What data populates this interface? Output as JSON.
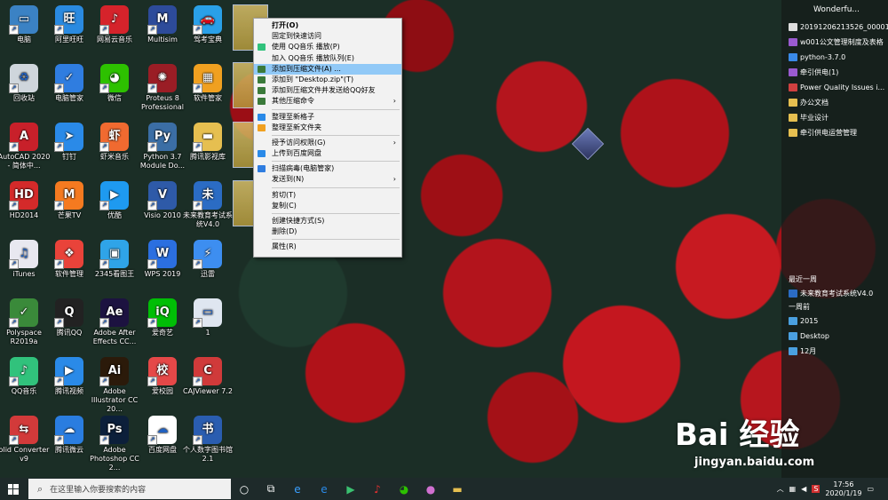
{
  "desktop_icons": [
    {
      "label": "电脑",
      "icon": "computer-icon",
      "color": "#3b82c4"
    },
    {
      "label": "阿里旺旺",
      "icon": "aliwangwang-icon",
      "color": "#2a8ae0"
    },
    {
      "label": "网易云音乐",
      "icon": "netease-music-icon",
      "color": "#d5232b"
    },
    {
      "label": "Multisim",
      "icon": "multisim-icon",
      "color": "#2d4b9a"
    },
    {
      "label": "驾考宝典",
      "icon": "car-icon",
      "color": "#2aa0e8"
    },
    {
      "label": "回收站",
      "icon": "recycle-bin-icon",
      "color": "#cfd6dc"
    },
    {
      "label": "电脑管家",
      "icon": "shield-icon",
      "color": "#2f7de0"
    },
    {
      "label": "微信",
      "icon": "wechat-icon",
      "color": "#2dc100"
    },
    {
      "label": "Proteus 8 Professional",
      "icon": "proteus-icon",
      "color": "#9a1d25"
    },
    {
      "label": "软件管家",
      "icon": "software-manager-icon",
      "color": "#f0a020"
    },
    {
      "label": "AutoCAD 2020 - 简体中...",
      "icon": "autocad-icon",
      "color": "#c8202a"
    },
    {
      "label": "钉钉",
      "icon": "dingtalk-icon",
      "color": "#2a8ae8"
    },
    {
      "label": "虾米音乐",
      "icon": "xiami-icon",
      "color": "#f06a30"
    },
    {
      "label": "Python 3.7 Module Do...",
      "icon": "python-icon",
      "color": "#3b6ea5"
    },
    {
      "label": "腾讯影视库",
      "icon": "folder-icon",
      "color": "#e6bf50"
    },
    {
      "label": "HD2014",
      "icon": "hd-icon",
      "color": "#d42a2a"
    },
    {
      "label": "芒果TV",
      "icon": "mango-tv-icon",
      "color": "#f57a20"
    },
    {
      "label": "优酷",
      "icon": "youku-icon",
      "color": "#1e9af0"
    },
    {
      "label": "Visio 2010",
      "icon": "visio-icon",
      "color": "#2e5aa8"
    },
    {
      "label": "未来教育考试系统V4.0",
      "icon": "exam-system-icon",
      "color": "#2b6cc4"
    },
    {
      "label": "iTunes",
      "icon": "itunes-icon",
      "color": "#e8e8f0"
    },
    {
      "label": "软件管理",
      "icon": "software-manage-icon",
      "color": "#e9433a"
    },
    {
      "label": "2345看图王",
      "icon": "image-viewer-icon",
      "color": "#2fa4e8"
    },
    {
      "label": "WPS 2019",
      "icon": "wps-icon",
      "color": "#2b6fe0"
    },
    {
      "label": "迅雷",
      "icon": "thunder-icon",
      "color": "#3d8ef0"
    },
    {
      "label": "Polyspace R2019a",
      "icon": "polyspace-icon",
      "color": "#3a8a3a"
    },
    {
      "label": "腾讯QQ",
      "icon": "qq-icon",
      "color": "#222222"
    },
    {
      "label": "Adobe After Effects CC...",
      "icon": "after-effects-icon",
      "color": "#1c1240"
    },
    {
      "label": "爱奇艺",
      "icon": "iqiyi-icon",
      "color": "#00be06"
    },
    {
      "label": "1",
      "icon": "file-icon",
      "color": "#dfe6f0"
    },
    {
      "label": "QQ音乐",
      "icon": "qq-music-icon",
      "color": "#31c27c"
    },
    {
      "label": "腾讯视频",
      "icon": "tencent-video-icon",
      "color": "#2a8ae8"
    },
    {
      "label": "Adobe Illustrator CC 20...",
      "icon": "illustrator-icon",
      "color": "#2b1a0a"
    },
    {
      "label": "爱校园",
      "icon": "campus-icon",
      "color": "#e54848"
    },
    {
      "label": "CAJViewer 7.2",
      "icon": "cajviewer-icon",
      "color": "#d03a3a"
    },
    {
      "label": "olid Converter v9",
      "icon": "converter-icon",
      "color": "#d23a3a"
    },
    {
      "label": "腾讯微云",
      "icon": "weiyun-icon",
      "color": "#2a7de0"
    },
    {
      "label": "Adobe Photoshop CC 2...",
      "icon": "photoshop-icon",
      "color": "#0c1f3a"
    },
    {
      "label": "百度网盘",
      "icon": "baidu-netdisk-icon",
      "color": "#ffffff"
    },
    {
      "label": "个人数字图书馆2.1",
      "icon": "digital-library-icon",
      "color": "#2a5db0"
    }
  ],
  "glyphs": {
    "computer-icon": "▭",
    "aliwangwang-icon": "旺",
    "netease-music-icon": "♪",
    "multisim-icon": "M",
    "car-icon": "🚗",
    "recycle-bin-icon": "♻",
    "shield-icon": "✓",
    "wechat-icon": "◕",
    "proteus-icon": "✺",
    "software-manager-icon": "▦",
    "autocad-icon": "A",
    "dingtalk-icon": "➤",
    "xiami-icon": "虾",
    "python-icon": "Py",
    "folder-icon": "▬",
    "hd-icon": "HD",
    "mango-tv-icon": "M",
    "youku-icon": "▶",
    "visio-icon": "V",
    "exam-system-icon": "未",
    "itunes-icon": "♫",
    "software-manage-icon": "❖",
    "image-viewer-icon": "▣",
    "wps-icon": "W",
    "thunder-icon": "⚡",
    "polyspace-icon": "✓",
    "qq-icon": "Q",
    "after-effects-icon": "Ae",
    "iqiyi-icon": "iQ",
    "file-icon": "▭",
    "qq-music-icon": "♪",
    "tencent-video-icon": "▶",
    "illustrator-icon": "Ai",
    "campus-icon": "校",
    "cajviewer-icon": "C",
    "converter-icon": "⇆",
    "weiyun-icon": "☁",
    "photoshop-icon": "Ps",
    "baidu-netdisk-icon": "☁",
    "digital-library-icon": "书"
  },
  "context_menu": [
    {
      "label": "打开(O)",
      "bold": true
    },
    {
      "label": "固定到快速访问"
    },
    {
      "label": "使用 QQ音乐 播放(P)",
      "icon_color": "#31c27c"
    },
    {
      "label": "加入 QQ音乐 播放队列(E)"
    },
    {
      "label": "添加到压缩文件(A) ...",
      "highlight": true,
      "icon_color": "#3a7a3a"
    },
    {
      "label": "添加到 \"Desktop.zip\"(T)",
      "icon_color": "#3a7a3a"
    },
    {
      "label": "添加到压缩文件并发送给QQ好友",
      "icon_color": "#3a7a3a"
    },
    {
      "label": "其他压缩命令",
      "submenu": true,
      "icon_color": "#3a7a3a"
    },
    {
      "sep": true
    },
    {
      "label": "整理至新格子",
      "icon_color": "#2a8ae8"
    },
    {
      "label": "整理至新文件夹",
      "icon_color": "#f0a020"
    },
    {
      "sep": true
    },
    {
      "label": "授予访问权限(G)",
      "submenu": true
    },
    {
      "label": "上传到百度网盘",
      "icon_color": "#2a8ae8"
    },
    {
      "sep": true
    },
    {
      "label": "扫描病毒(电脑管家)",
      "icon_color": "#2f7de0"
    },
    {
      "label": "发送到(N)",
      "submenu": true
    },
    {
      "sep": true
    },
    {
      "label": "剪切(T)"
    },
    {
      "label": "复制(C)"
    },
    {
      "sep": true
    },
    {
      "label": "创建快捷方式(S)"
    },
    {
      "label": "删除(D)"
    },
    {
      "sep": true
    },
    {
      "label": "属性(R)"
    }
  ],
  "right_panel": {
    "title": "Wonderfu...",
    "items": [
      {
        "label": "20191206213526_00001",
        "color": "#dddddd"
      },
      {
        "label": "w001公文管理制度及表格",
        "color": "#9a5ad0"
      },
      {
        "label": "python-3.7.0",
        "color": "#3a8ae8"
      },
      {
        "label": "牵引供电(1)",
        "color": "#9a5ad0"
      },
      {
        "label": "Power Quality Issues i...",
        "color": "#d04040"
      },
      {
        "label": "办公文档",
        "color": "#e6bf50"
      },
      {
        "label": "毕业设计",
        "color": "#e6bf50"
      },
      {
        "label": "牵引供电运营管理",
        "color": "#e6bf50"
      }
    ],
    "recent_week_label": "最近一周",
    "recent_week_items": [
      {
        "label": "未来教育考试系统V4.0",
        "color": "#2b6cc4"
      }
    ],
    "week_ago_label": "一周前",
    "week_ago_items": [
      {
        "label": "2015",
        "color": "#4aa0e0"
      },
      {
        "label": "Desktop",
        "color": "#4aa0e0"
      },
      {
        "label": "12月",
        "color": "#4aa0e0"
      }
    ]
  },
  "taskbar": {
    "search_placeholder": "在这里输入你要搜索的内容",
    "time": "17:56",
    "date": "2020/1/19",
    "apps": [
      "cortana-icon",
      "task-view-icon",
      "ie-icon",
      "edge-icon",
      "media-icon",
      "netease-music-icon",
      "wechat-icon",
      "photo-icon",
      "file-explorer-icon"
    ]
  },
  "watermark": {
    "logo": "Bai 经验",
    "url": "jingyan.baidu.com"
  }
}
